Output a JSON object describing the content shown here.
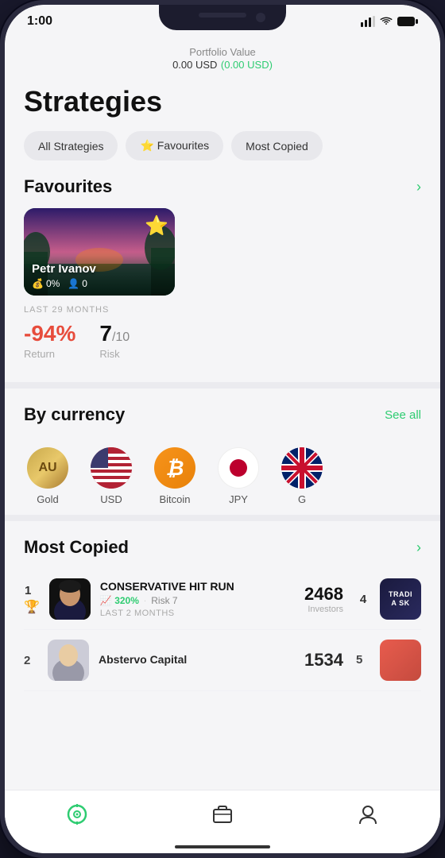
{
  "statusBar": {
    "time": "1:00",
    "locationIcon": "▶"
  },
  "portfolio": {
    "label": "Portfolio Value",
    "value": "0.00 USD",
    "change": "(0.00 USD)"
  },
  "page": {
    "title": "Strategies"
  },
  "filterTabs": [
    {
      "id": "all",
      "label": "All Strategies",
      "active": false
    },
    {
      "id": "favourites",
      "label": "⭐ Favourites",
      "active": false
    },
    {
      "id": "most-copied",
      "label": "Most Copied",
      "active": false
    }
  ],
  "sections": {
    "favourites": {
      "title": "Favourites",
      "seeAllIcon": "›"
    },
    "byCurrency": {
      "title": "By currency",
      "seeAll": "See all"
    },
    "mostCopied": {
      "title": "Most Copied",
      "seeAllIcon": "›"
    }
  },
  "favouriteCard": {
    "name": "Petr Ivanov",
    "return_pct": "0%",
    "followers": "0",
    "starIcon": "⭐",
    "period": "LAST 29 MONTHS",
    "returnValue": "-94%",
    "returnLabel": "Return",
    "riskValue": "7",
    "riskSub": "/10",
    "riskLabel": "Risk"
  },
  "currencies": [
    {
      "id": "gold",
      "type": "gold",
      "label": "Gold",
      "symbol": "AU"
    },
    {
      "id": "usd",
      "type": "usd",
      "label": "USD",
      "symbol": ""
    },
    {
      "id": "bitcoin",
      "type": "bitcoin",
      "label": "Bitcoin",
      "symbol": "₿"
    },
    {
      "id": "jpy",
      "type": "jpy",
      "label": "JPY",
      "symbol": ""
    },
    {
      "id": "gbp",
      "type": "gbp",
      "label": "G",
      "symbol": ""
    }
  ],
  "mostCopied": [
    {
      "rank": "1",
      "name": "CONSERVATIVE HIT RUN",
      "return": "320%",
      "risk": "7",
      "period": "LAST 2 MONTHS",
      "investors": "2468",
      "rankSuffix": "4",
      "thumbText": "TRADI\nA SK"
    },
    {
      "rank": "2",
      "name": "Abstervo Capital",
      "return": "",
      "risk": "",
      "period": "",
      "investors": "1534",
      "rankSuffix": "5"
    }
  ],
  "bottomNav": [
    {
      "id": "scan",
      "icon": "◎",
      "active": true
    },
    {
      "id": "portfolio",
      "icon": "🗂",
      "active": false
    },
    {
      "id": "profile",
      "icon": "👤",
      "active": false
    }
  ]
}
